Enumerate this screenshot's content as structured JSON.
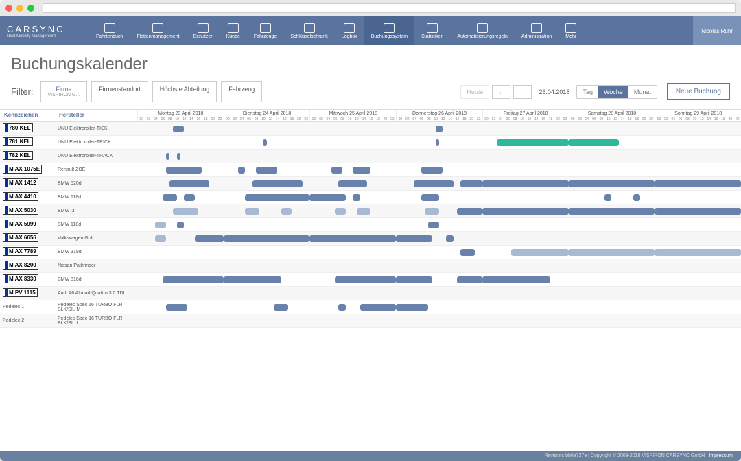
{
  "brand": {
    "name": "CARSYNC",
    "tag": "Next Mobility Management"
  },
  "nav": [
    {
      "label": "Fahrtenbuch"
    },
    {
      "label": "Flottenmanagement"
    },
    {
      "label": "Benutzer"
    },
    {
      "label": "Kunde"
    },
    {
      "label": "Fahrzeuge"
    },
    {
      "label": "Schlüsselschrank"
    },
    {
      "label": "Logbox"
    },
    {
      "label": "Buchungssystem",
      "active": true
    },
    {
      "label": "Statistiken"
    },
    {
      "label": "Automatisierungsregeln"
    },
    {
      "label": "Administration"
    },
    {
      "label": "Mehr"
    }
  ],
  "user": "Nicolas Rühr",
  "page_title": "Buchungskalender",
  "filter": {
    "label": "Filter:",
    "buttons": [
      {
        "label": "Firma",
        "sub": "VISPIRON G...",
        "active": true
      },
      {
        "label": "Firmenstandort"
      },
      {
        "label": "Höchste Abteilung"
      },
      {
        "label": "Fahrzeug"
      }
    ]
  },
  "toolbar": {
    "today": "Heute",
    "prev": "←",
    "next": "→",
    "date": "26.04.2018",
    "views": [
      "Tag",
      "Woche",
      "Monat"
    ],
    "active_view": "Woche",
    "new_booking": "Neue Buchung"
  },
  "columns": {
    "kz": "Kennzeichen",
    "hr": "Hersteller"
  },
  "days": [
    "Montag 23 April 2018",
    "Dienstag 24 April 2018",
    "Mittwoch 25 April 2018",
    "Donnerstag 26 April 2018",
    "Freitag 27 April 2018",
    "Samstag 28 April 2018",
    "Sonntag 29 April 2018"
  ],
  "hours": [
    "00",
    "02",
    "04",
    "06",
    "08",
    "10",
    "12",
    "14",
    "16",
    "18",
    "20",
    "22"
  ],
  "rows": [
    {
      "plate": "780 KEL",
      "hr": "UNU Elektroroller-TICK",
      "bars": [
        {
          "d": 0,
          "s": 10,
          "e": 13,
          "c": "blue"
        },
        {
          "d": 3,
          "s": 11,
          "e": 13,
          "c": "blue"
        }
      ]
    },
    {
      "plate": "781 KEL",
      "hr": "UNU Elektroroller-TRICK",
      "bars": [
        {
          "d": 1,
          "s": 11,
          "e": 12,
          "c": "blue"
        },
        {
          "d": 3,
          "s": 11,
          "e": 12,
          "c": "blue"
        },
        {
          "d": 4,
          "s": 4,
          "e": 24,
          "c": "teal"
        },
        {
          "d": 5,
          "s": 0,
          "e": 14,
          "c": "teal"
        }
      ]
    },
    {
      "plate": "782 KEL",
      "hr": "UNU Elektroroller-TRACK",
      "bars": [
        {
          "d": 0,
          "s": 8,
          "e": 9,
          "c": "blue"
        },
        {
          "d": 0,
          "s": 11,
          "e": 12,
          "c": "blue"
        }
      ]
    },
    {
      "plate": "M AX 1075E",
      "hr": "Renault ZOE",
      "bars": [
        {
          "d": 0,
          "s": 8,
          "e": 18,
          "c": "blue"
        },
        {
          "d": 1,
          "s": 4,
          "e": 6,
          "c": "blue"
        },
        {
          "d": 1,
          "s": 9,
          "e": 15,
          "c": "blue"
        },
        {
          "d": 2,
          "s": 6,
          "e": 9,
          "c": "blue"
        },
        {
          "d": 2,
          "s": 12,
          "e": 17,
          "c": "blue"
        },
        {
          "d": 3,
          "s": 7,
          "e": 13,
          "c": "blue"
        }
      ]
    },
    {
      "plate": "M AX 1412",
      "hr": "BMW 520d",
      "bars": [
        {
          "d": 0,
          "s": 9,
          "e": 20,
          "c": "blue"
        },
        {
          "d": 1,
          "s": 8,
          "e": 22,
          "c": "blue"
        },
        {
          "d": 2,
          "s": 8,
          "e": 16,
          "c": "blue"
        },
        {
          "d": 3,
          "s": 5,
          "e": 16,
          "c": "blue"
        },
        {
          "d": 3,
          "s": 18,
          "e": 24,
          "c": "blue"
        },
        {
          "d": 4,
          "s": 0,
          "e": 24,
          "c": "blue"
        },
        {
          "d": 5,
          "s": 0,
          "e": 24,
          "c": "blue"
        },
        {
          "d": 6,
          "s": 0,
          "e": 24,
          "c": "blue"
        }
      ]
    },
    {
      "plate": "M AX 4410",
      "hr": "BMW 118d",
      "bars": [
        {
          "d": 0,
          "s": 7,
          "e": 11,
          "c": "blue"
        },
        {
          "d": 0,
          "s": 13,
          "e": 16,
          "c": "blue"
        },
        {
          "d": 1,
          "s": 6,
          "e": 24,
          "c": "blue"
        },
        {
          "d": 2,
          "s": 0,
          "e": 10,
          "c": "blue"
        },
        {
          "d": 2,
          "s": 12,
          "e": 14,
          "c": "blue"
        },
        {
          "d": 3,
          "s": 7,
          "e": 12,
          "c": "blue"
        },
        {
          "d": 5,
          "s": 10,
          "e": 12,
          "c": "blue"
        },
        {
          "d": 5,
          "s": 18,
          "e": 20,
          "c": "blue"
        }
      ]
    },
    {
      "plate": "M AX 5030",
      "hr": "BMW i3",
      "bars": [
        {
          "d": 0,
          "s": 10,
          "e": 17,
          "c": "lblue"
        },
        {
          "d": 1,
          "s": 6,
          "e": 10,
          "c": "lblue"
        },
        {
          "d": 1,
          "s": 16,
          "e": 19,
          "c": "lblue"
        },
        {
          "d": 2,
          "s": 7,
          "e": 10,
          "c": "lblue"
        },
        {
          "d": 2,
          "s": 13,
          "e": 17,
          "c": "lblue"
        },
        {
          "d": 3,
          "s": 8,
          "e": 12,
          "c": "lblue"
        },
        {
          "d": 3,
          "s": 17,
          "e": 24,
          "c": "blue"
        },
        {
          "d": 4,
          "s": 0,
          "e": 24,
          "c": "blue"
        },
        {
          "d": 5,
          "s": 0,
          "e": 24,
          "c": "blue"
        },
        {
          "d": 6,
          "s": 0,
          "e": 24,
          "c": "blue"
        }
      ]
    },
    {
      "plate": "M AX 5999",
      "hr": "BMW 118d",
      "bars": [
        {
          "d": 0,
          "s": 5,
          "e": 8,
          "c": "lblue"
        },
        {
          "d": 0,
          "s": 11,
          "e": 13,
          "c": "blue"
        },
        {
          "d": 3,
          "s": 9,
          "e": 12,
          "c": "blue"
        }
      ]
    },
    {
      "plate": "M AX 6656",
      "hr": "Volkswagen Golf",
      "bars": [
        {
          "d": 0,
          "s": 5,
          "e": 8,
          "c": "lblue"
        },
        {
          "d": 0,
          "s": 16,
          "e": 24,
          "c": "blue"
        },
        {
          "d": 1,
          "s": 0,
          "e": 24,
          "c": "blue"
        },
        {
          "d": 2,
          "s": 0,
          "e": 24,
          "c": "blue"
        },
        {
          "d": 3,
          "s": 0,
          "e": 10,
          "c": "blue"
        },
        {
          "d": 3,
          "s": 14,
          "e": 16,
          "c": "blue"
        }
      ]
    },
    {
      "plate": "M AX 7789",
      "hr": "BMW 318d",
      "bars": [
        {
          "d": 3,
          "s": 18,
          "e": 22,
          "c": "blue"
        },
        {
          "d": 4,
          "s": 8,
          "e": 24,
          "c": "lblue"
        },
        {
          "d": 5,
          "s": 0,
          "e": 24,
          "c": "lblue"
        },
        {
          "d": 6,
          "s": 0,
          "e": 24,
          "c": "lblue"
        }
      ]
    },
    {
      "plate": "M AX 8200",
      "hr": "Nissan Pathfinder",
      "bars": []
    },
    {
      "plate": "M AX 8330",
      "hr": "BMW 318d",
      "bars": [
        {
          "d": 0,
          "s": 7,
          "e": 24,
          "c": "blue"
        },
        {
          "d": 1,
          "s": 0,
          "e": 16,
          "c": "blue"
        },
        {
          "d": 2,
          "s": 7,
          "e": 24,
          "c": "blue"
        },
        {
          "d": 3,
          "s": 0,
          "e": 10,
          "c": "blue"
        },
        {
          "d": 3,
          "s": 17,
          "e": 24,
          "c": "blue"
        },
        {
          "d": 4,
          "s": 0,
          "e": 19,
          "c": "blue"
        }
      ]
    },
    {
      "plate": "M PV 1115",
      "hr": "Audi A6 Allroad Quattro 3.0 TDI",
      "bars": []
    },
    {
      "plate": "Pedelec 1",
      "hr": "Pedelec Spec 16 TURBO FLR BLK/SIL M",
      "noplate": true,
      "bars": [
        {
          "d": 0,
          "s": 8,
          "e": 14,
          "c": "blue"
        },
        {
          "d": 1,
          "s": 14,
          "e": 18,
          "c": "blue"
        },
        {
          "d": 2,
          "s": 8,
          "e": 10,
          "c": "blue"
        },
        {
          "d": 2,
          "s": 14,
          "e": 24,
          "c": "blue"
        },
        {
          "d": 3,
          "s": 0,
          "e": 9,
          "c": "blue"
        }
      ]
    },
    {
      "plate": "Pedelec 2",
      "hr": "Pedelec Spec 16 TURBO FLR BLK/SIL L",
      "noplate": true,
      "bars": []
    }
  ],
  "footer": {
    "text": "Revision: bb6e727e | Copyright © 2009-2018 VISPIRON CARSYNC GmbH · ",
    "link": "Impressum"
  }
}
